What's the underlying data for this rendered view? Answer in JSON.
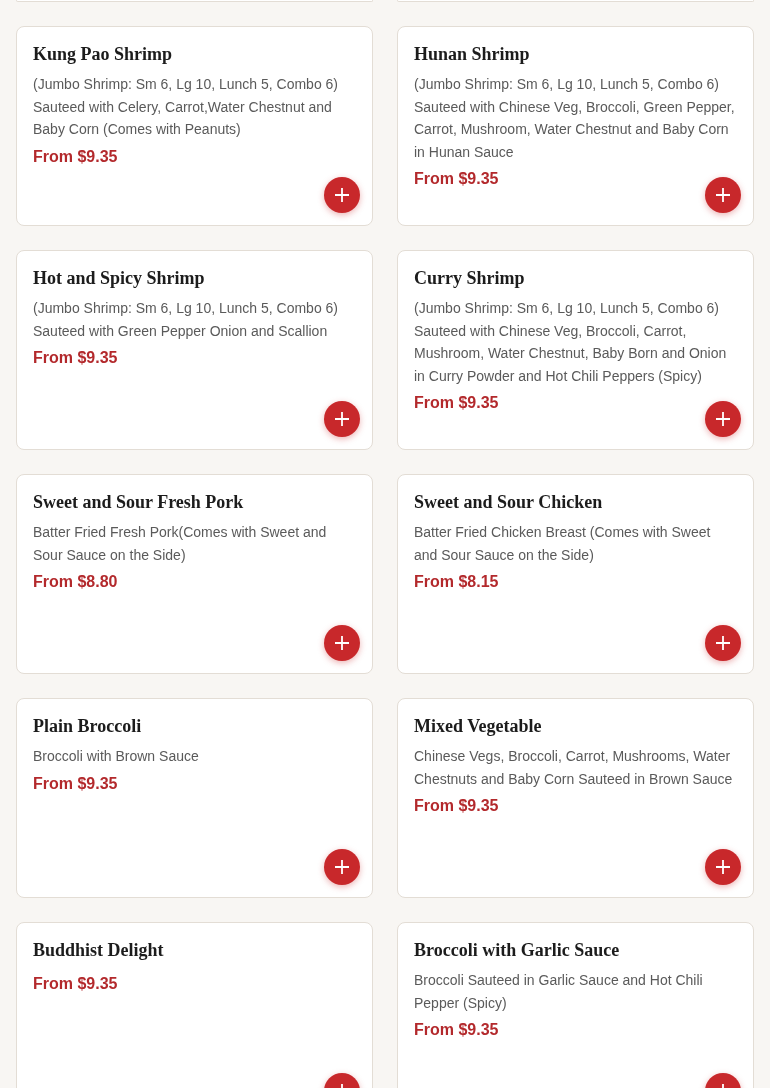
{
  "items": [
    {
      "name": "Kung Pao Shrimp",
      "description": "(Jumbo Shrimp: Sm 6, Lg 10, Lunch 5, Combo 6) Sauteed with Celery, Carrot,Water Chestnut and Baby Corn (Comes with Peanuts)",
      "price": "From $9.35"
    },
    {
      "name": "Hunan Shrimp",
      "description": "(Jumbo Shrimp: Sm 6, Lg 10, Lunch 5, Combo 6) Sauteed with Chinese Veg, Broccoli, Green Pepper, Carrot, Mushroom, Water Chestnut and Baby Corn in Hunan Sauce",
      "price": "From $9.35"
    },
    {
      "name": "Hot and Spicy Shrimp",
      "description": "(Jumbo Shrimp: Sm 6, Lg 10, Lunch 5, Combo 6) Sauteed with Green Pepper Onion and Scallion",
      "price": "From $9.35"
    },
    {
      "name": "Curry Shrimp",
      "description": "(Jumbo Shrimp: Sm 6, Lg 10, Lunch 5, Combo 6) Sauteed with Chinese Veg, Broccoli, Carrot, Mushroom, Water Chestnut, Baby Born and Onion in Curry Powder and Hot Chili Peppers (Spicy)",
      "price": "From $9.35"
    },
    {
      "name": "Sweet and Sour Fresh Pork",
      "description": "Batter Fried Fresh Pork(Comes with Sweet and Sour Sauce on the Side)",
      "price": "From $8.80"
    },
    {
      "name": "Sweet and Sour Chicken",
      "description": "Batter Fried Chicken Breast (Comes with Sweet and Sour Sauce on the Side)",
      "price": "From $8.15"
    },
    {
      "name": "Plain Broccoli",
      "description": "Broccoli with Brown Sauce",
      "price": "From $9.35"
    },
    {
      "name": "Mixed Vegetable",
      "description": "Chinese Vegs, Broccoli, Carrot, Mushrooms, Water Chestnuts and Baby Corn Sauteed in Brown Sauce",
      "price": "From $9.35"
    },
    {
      "name": "Buddhist Delight",
      "price": "From $9.35"
    },
    {
      "name": "Broccoli with Garlic Sauce",
      "description": "Broccoli Sauteed in Garlic Sauce and Hot Chili Pepper (Spicy)",
      "price": "From $9.35"
    }
  ]
}
